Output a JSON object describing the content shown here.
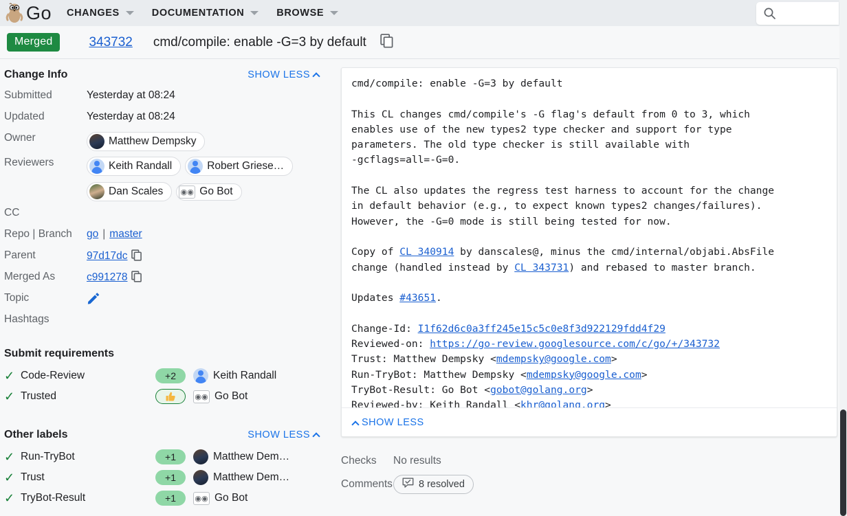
{
  "header": {
    "brand": "Go",
    "gopher_icon": "go-gopher-logo",
    "nav": [
      {
        "label": "CHANGES",
        "icon": "chevron-down-icon"
      },
      {
        "label": "DOCUMENTATION",
        "icon": "chevron-down-icon"
      },
      {
        "label": "BROWSE",
        "icon": "chevron-down-icon"
      }
    ],
    "search": {
      "icon": "search-icon",
      "value": "",
      "placeholder": ""
    }
  },
  "change": {
    "status": "Merged",
    "number": "343732",
    "subject": "cmd/compile: enable -G=3 by default",
    "copy_icon": "copy-icon"
  },
  "sidebar": {
    "change_info": {
      "title": "Change Info",
      "toggle": "SHOW LESS",
      "toggle_icon": "chevron-up-icon",
      "rows": [
        {
          "key": "Submitted",
          "value": "Yesterday at 08:24"
        },
        {
          "key": "Updated",
          "value": "Yesterday at 08:24"
        }
      ],
      "owner_label": "Owner",
      "owner": {
        "name": "Matthew Dempsky",
        "avatar": "avatar-photo"
      },
      "reviewers_label": "Reviewers",
      "reviewers": [
        {
          "name": "Keith Randall",
          "avatar": "avatar-default"
        },
        {
          "name": "Robert Griese…",
          "avatar": "avatar-default"
        },
        {
          "name": "Dan Scales",
          "avatar": "avatar-photo"
        },
        {
          "name": "Go Bot",
          "avatar": "avatar-bot"
        }
      ],
      "cc_label": "CC",
      "cc": "",
      "repo_branch_label": "Repo | Branch",
      "repo": "go",
      "branch": "master",
      "parent_label": "Parent",
      "parent": "97d17dc",
      "merged_as_label": "Merged As",
      "merged_as": "c991278",
      "topic_label": "Topic",
      "topic_edit_icon": "pencil-icon",
      "hashtags_label": "Hashtags",
      "hashtags": ""
    },
    "submit_requirements": {
      "title": "Submit requirements",
      "rows": [
        {
          "status_icon": "check-icon",
          "name": "Code-Review",
          "vote": "+2",
          "vote_style": "solid",
          "voter": "Keith Randall",
          "avatar": "avatar-default"
        },
        {
          "status_icon": "check-icon",
          "name": "Trusted",
          "vote": "👍",
          "vote_style": "outline",
          "voter": "Go Bot",
          "avatar": "avatar-bot"
        }
      ]
    },
    "other_labels": {
      "title": "Other labels",
      "toggle": "SHOW LESS",
      "toggle_icon": "chevron-up-icon",
      "rows": [
        {
          "status_icon": "check-icon",
          "name": "Run-TryBot",
          "vote": "+1",
          "vote_style": "solid",
          "voter": "Matthew Dem…",
          "avatar": "avatar-photo"
        },
        {
          "status_icon": "check-icon",
          "name": "Trust",
          "vote": "+1",
          "vote_style": "solid",
          "voter": "Matthew Dem…",
          "avatar": "avatar-photo"
        },
        {
          "status_icon": "check-icon",
          "name": "TryBot-Result",
          "vote": "+1",
          "vote_style": "solid",
          "voter": "Go Bot",
          "avatar": "avatar-bot"
        }
      ]
    }
  },
  "commit": {
    "subject": "cmd/compile: enable -G=3 by default",
    "paragraph1": "This CL changes cmd/compile's -G flag's default from 0 to 3, which\nenables use of the new types2 type checker and support for type\nparameters. The old type checker is still available with\n-gcflags=all=-G=0.",
    "paragraph2": "The CL also updates the regress test harness to account for the change\nin default behavior (e.g., to expect known types2 changes/failures).\nHowever, the -G=0 mode is still being tested for now.",
    "copy_prefix": "Copy of ",
    "cl_340914": "CL 340914",
    "copy_middle": " by danscales@, minus the cmd/internal/objabi.AbsFile\nchange (handled instead by ",
    "cl_343731": "CL 343731",
    "copy_suffix": ") and rebased to master branch.",
    "updates_prefix": "Updates ",
    "issue": "#43651",
    "updates_suffix": ".",
    "change_id_key": "Change-Id: ",
    "change_id": "I1f62d6c0a3ff245e15c5c0e8f3d922129fdd4f29",
    "reviewed_on_key": "Reviewed-on: ",
    "reviewed_on": "https://go-review.googlesource.com/c/go/+/343732",
    "trust_key": "Trust: Matthew Dempsky <",
    "trust_email": "mdempsky@google.com",
    "trust_suffix": ">",
    "runtrybot_key": "Run-TryBot: Matthew Dempsky <",
    "runtrybot_email": "mdempsky@google.com",
    "runtrybot_suffix": ">",
    "trybotresult_key": "TryBot-Result: Go Bot <",
    "trybotresult_email": "gobot@golang.org",
    "trybotresult_suffix": ">",
    "reviewedby_key": "Reviewed-by: Keith Randall <",
    "reviewedby_email": "khr@golang.org",
    "reviewedby_suffix": ">",
    "toggle": "SHOW LESS",
    "toggle_icon": "chevron-up-icon"
  },
  "meta": {
    "checks_label": "Checks",
    "checks_value": "No results",
    "comments_label": "Comments",
    "comments_icon": "comment-resolved-icon",
    "comments_value": "8 resolved"
  },
  "colors": {
    "merged_green": "#1e8a42",
    "link_blue": "#1a5fd0",
    "action_blue": "#1a73e8",
    "check_green": "#188038",
    "vote_pill_green": "#8fd7a6",
    "header_bg": "#e9ecef",
    "page_bg": "#f7f8f9"
  }
}
